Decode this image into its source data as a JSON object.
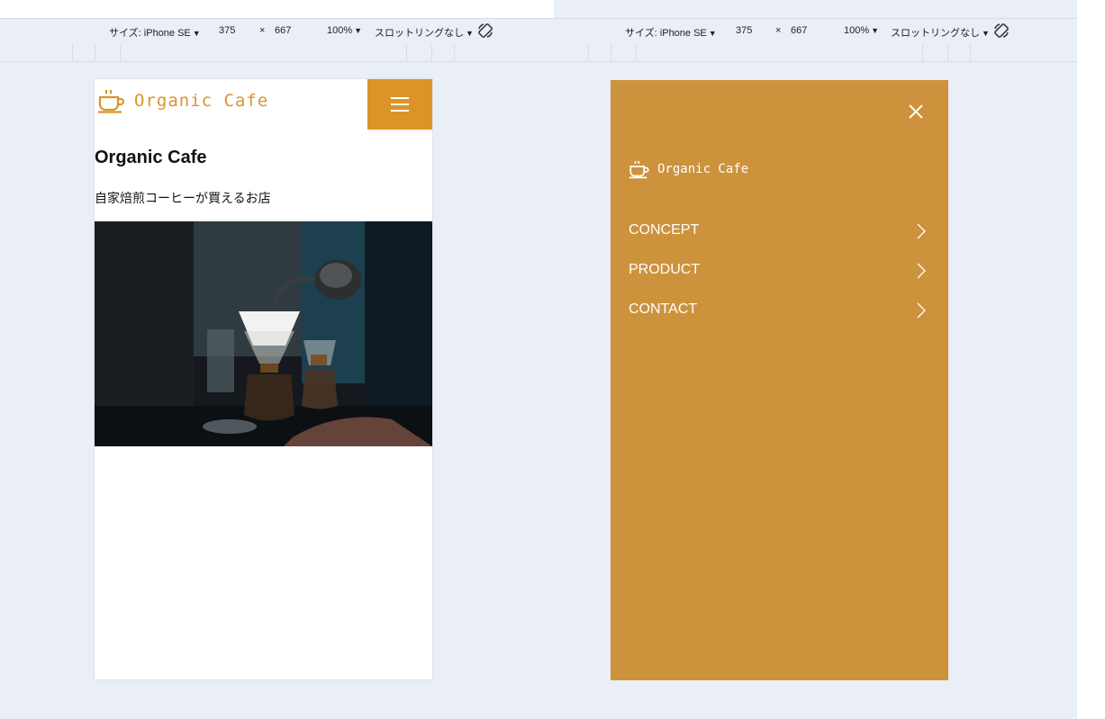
{
  "devtools": {
    "left": {
      "size_label": "サイズ: iPhone SE",
      "width_value": "375",
      "times": "×",
      "height_value": "667",
      "zoom": "100%",
      "throttle": "スロットリングなし"
    },
    "right": {
      "size_label": "サイズ: iPhone SE",
      "width_value": "375",
      "times": "×",
      "height_value": "667",
      "zoom": "100%",
      "throttle": "スロットリングなし"
    }
  },
  "site": {
    "logo_text": "Organic Cafe",
    "hero_title": "Organic Cafe",
    "hero_subtitle": "自家焙煎コーヒーが買えるお店"
  },
  "menu": {
    "logo_text": "Organic Cafe",
    "items": [
      {
        "label": "CONCEPT"
      },
      {
        "label": "PRODUCT"
      },
      {
        "label": "CONTACT"
      }
    ]
  },
  "colors": {
    "accent": "#dd9426",
    "menu_bg": "#cd923c",
    "logo_text": "#d9952f",
    "page_bg": "#e9eef7"
  },
  "icons": {
    "logo": "coffee-cup-icon",
    "menu_toggle": "hamburger-icon",
    "close": "close-icon",
    "rotate": "rotate-icon",
    "item_arrow": "chevron-right-icon"
  }
}
